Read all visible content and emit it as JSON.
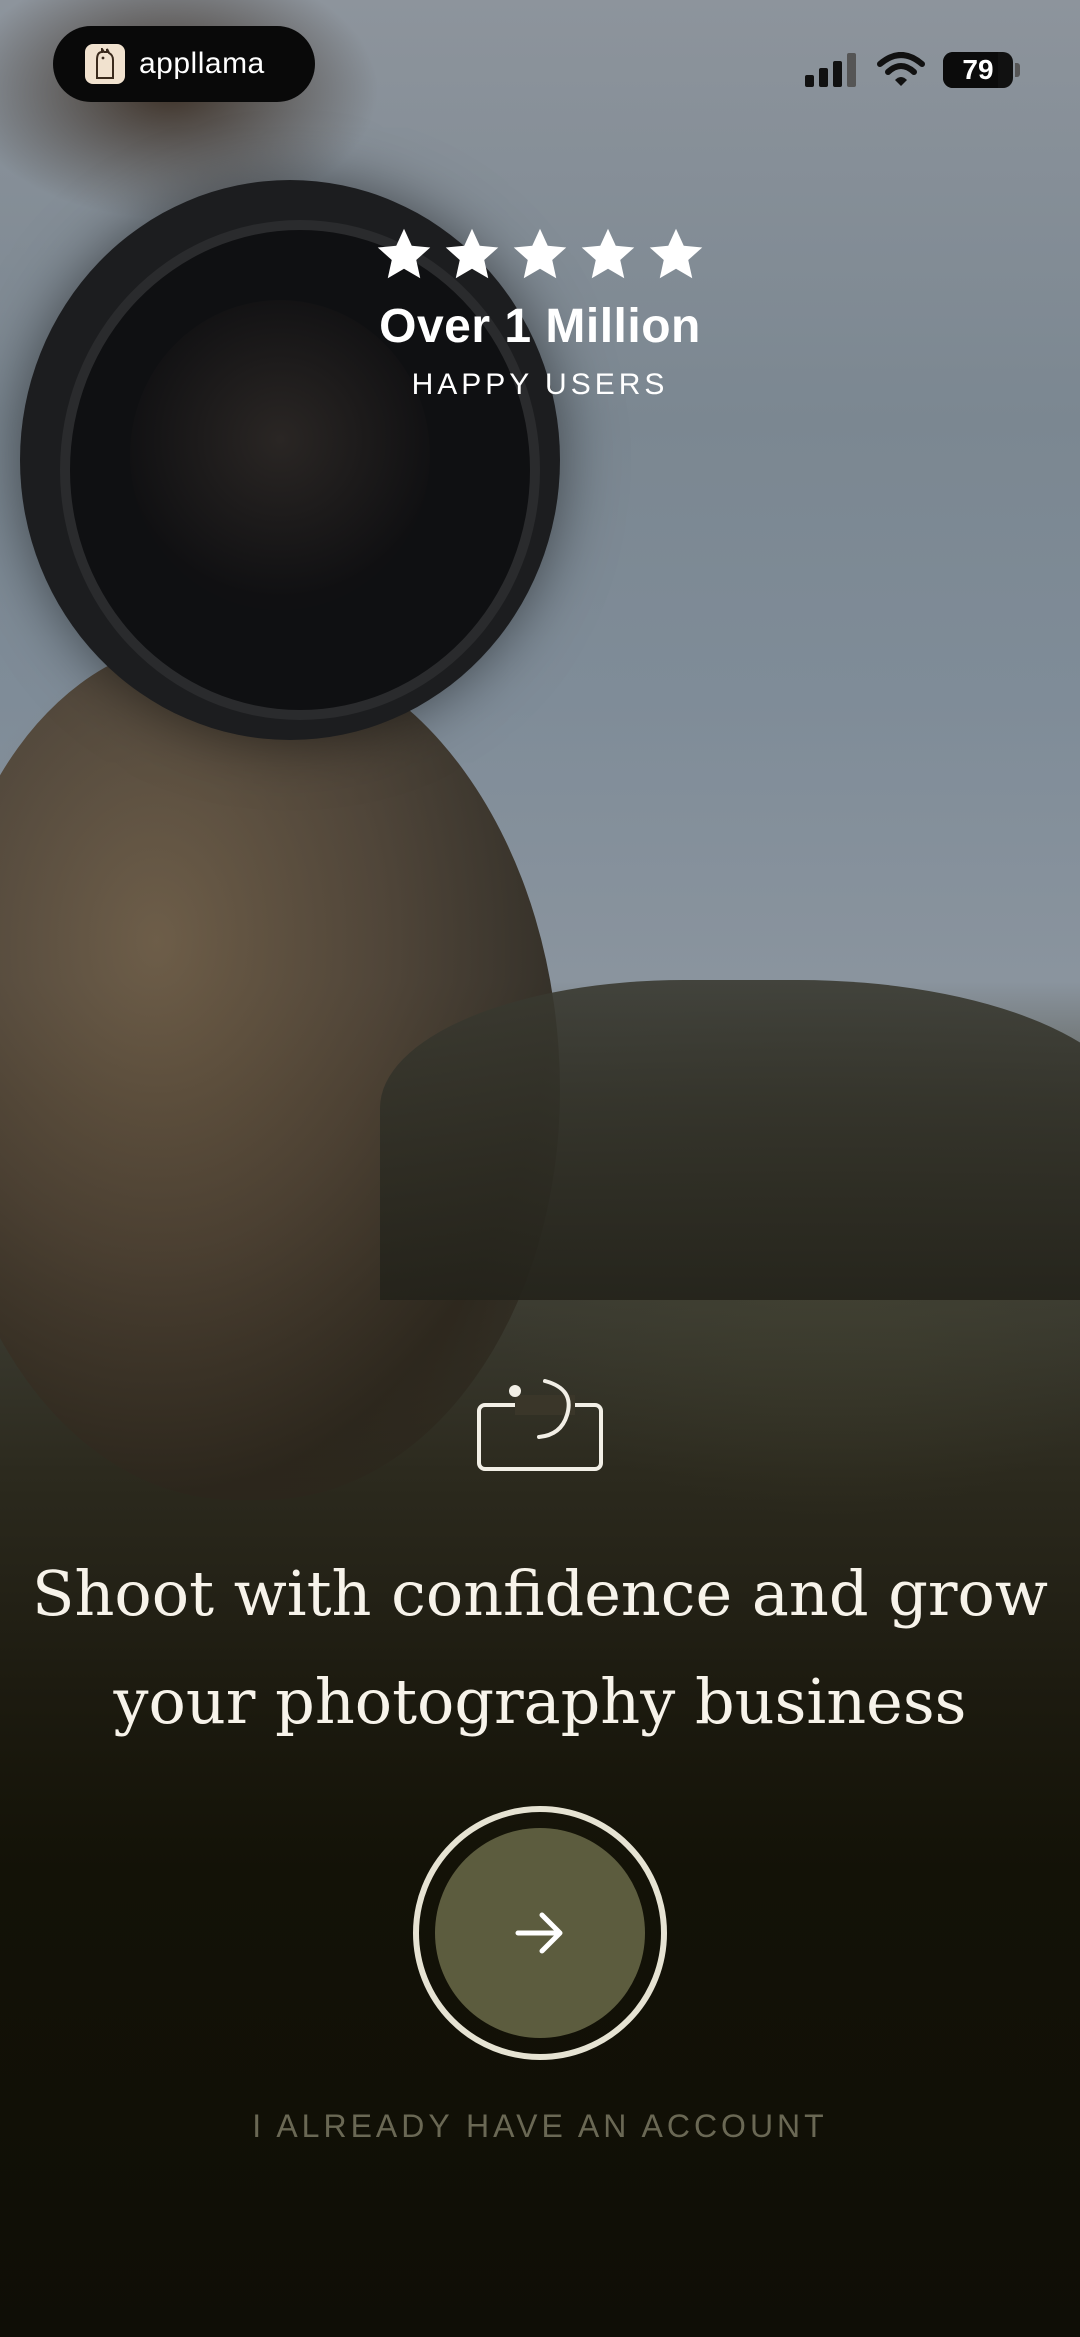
{
  "status_bar": {
    "brand_name": "appllama",
    "battery": "79",
    "battery_level": 0.79
  },
  "rating": {
    "star_count": 5,
    "headline": "Over 1 Million",
    "subline": "HAPPY USERS"
  },
  "main": {
    "tagline_line1": "Shoot with confidence and grow",
    "tagline_line2": "your photography business",
    "next_icon": "arrow-right-icon",
    "login_label": "I ALREADY HAVE AN ACCOUNT"
  },
  "colors": {
    "button_fill": "#5c5c3e",
    "button_ring": "#e6e3d3",
    "login_text": "#6a6854",
    "background_bottom": "#111006"
  }
}
